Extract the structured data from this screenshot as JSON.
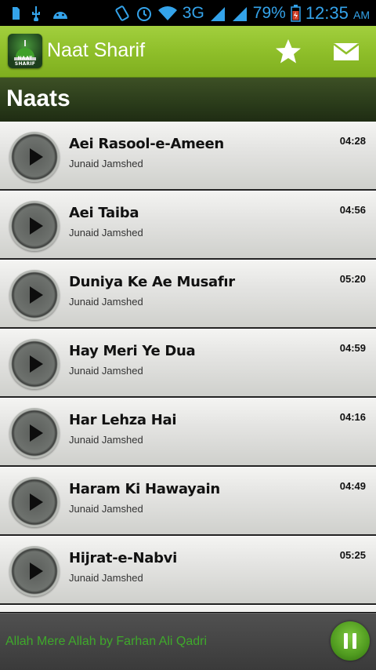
{
  "status_bar": {
    "network": "3G",
    "battery": "79%",
    "time": "12:35",
    "ampm": "AM"
  },
  "action_bar": {
    "title": "Naat Sharif",
    "icon_label": "NAAT SHARIF",
    "favorite_icon": "star-icon",
    "message_icon": "mail-icon",
    "accent": "#8fbf2a"
  },
  "section": {
    "title": "Naats"
  },
  "tracks": [
    {
      "title": "Aei Rasool-e-Ameen",
      "artist": "Junaid Jamshed",
      "duration": "04:28"
    },
    {
      "title": "Aei Taiba",
      "artist": "Junaid Jamshed",
      "duration": "04:56"
    },
    {
      "title": "Duniya Ke Ae Musafır",
      "artist": "Junaid Jamshed",
      "duration": "05:20"
    },
    {
      "title": "Hay Meri Ye Dua",
      "artist": "Junaid Jamshed",
      "duration": "04:59"
    },
    {
      "title": "Har Lehza Hai",
      "artist": "Junaid Jamshed",
      "duration": "04:16"
    },
    {
      "title": "Haram Ki Hawayain",
      "artist": "Junaid Jamshed",
      "duration": "04:49"
    },
    {
      "title": "Hijrat-e-Nabvi",
      "artist": "Junaid Jamshed",
      "duration": "05:25"
    }
  ],
  "player": {
    "now_playing": "Allah Mere Allah by Farhan Ali Qadri",
    "control_icon": "pause-icon",
    "now_playing_color": "#3fa92b"
  }
}
